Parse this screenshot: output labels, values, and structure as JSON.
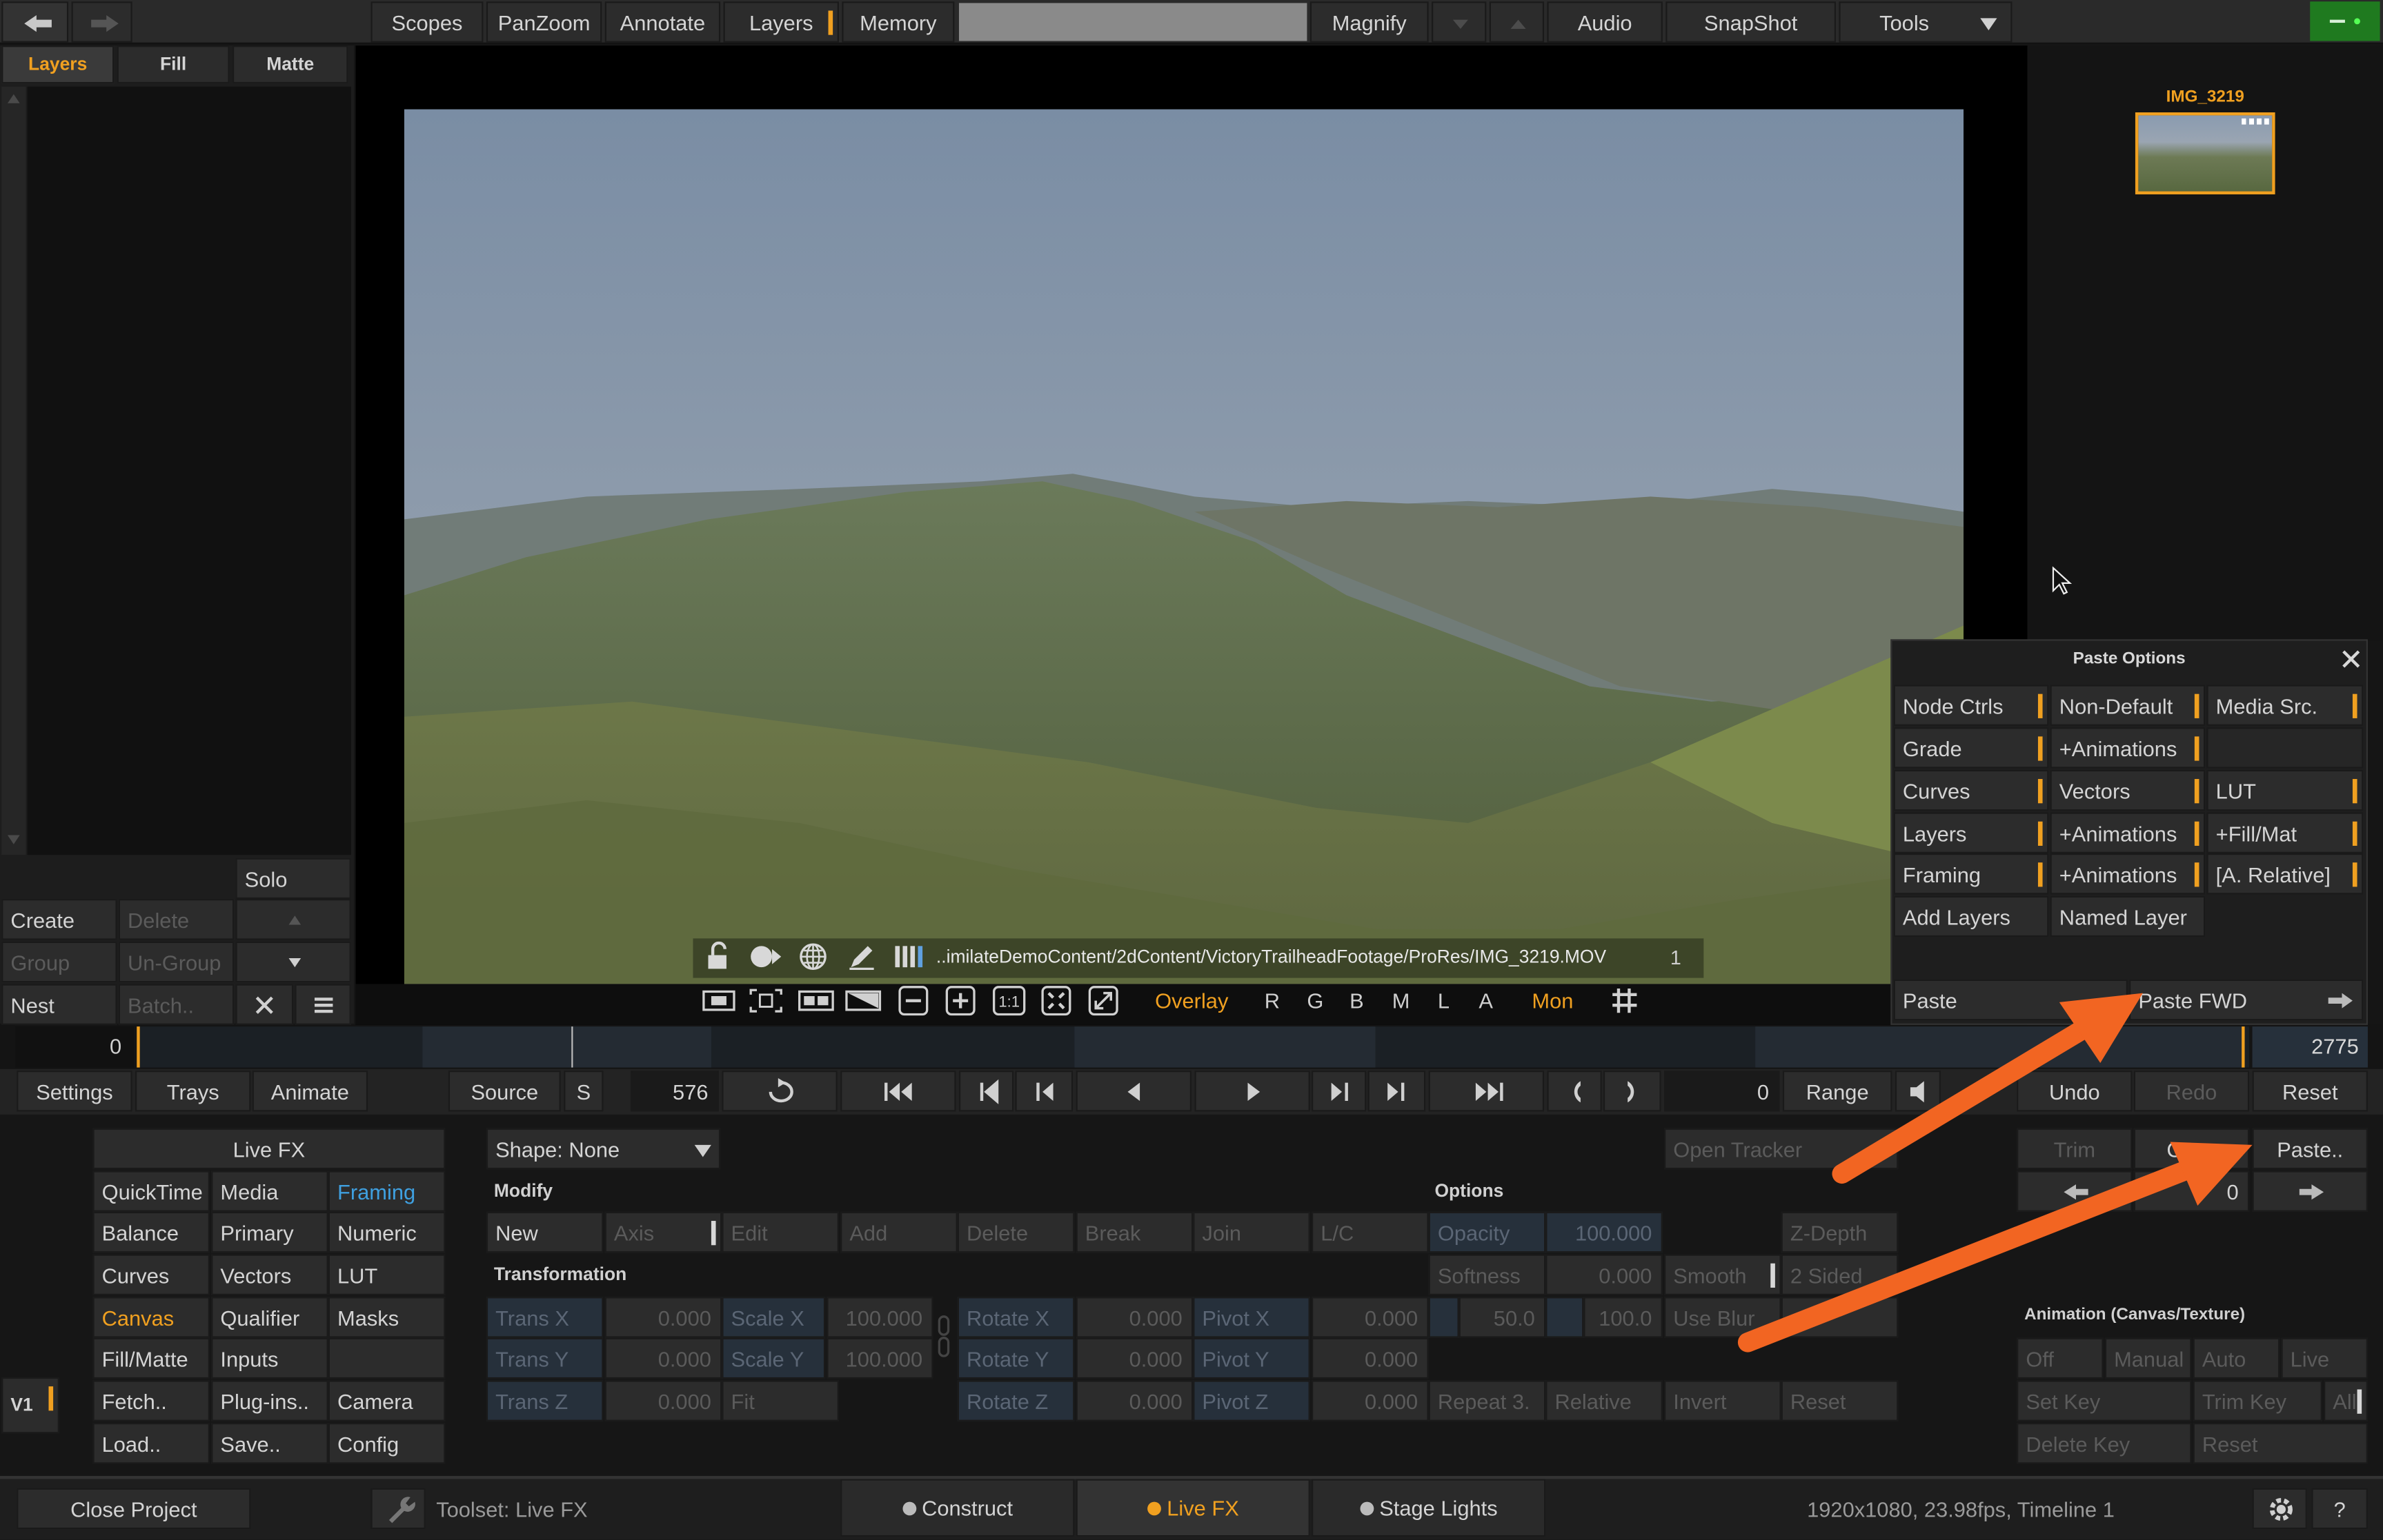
{
  "topbar": {
    "scopes": "Scopes",
    "panzoom": "PanZoom",
    "annotate": "Annotate",
    "layers": "Layers",
    "memory": "Memory",
    "magnify": "Magnify",
    "audio": "Audio",
    "snapshot": "SnapShot",
    "tools": "Tools"
  },
  "left_tabs": {
    "layers": "Layers",
    "fill": "Fill",
    "matte": "Matte"
  },
  "left_buttons": {
    "solo": "Solo",
    "create": "Create",
    "delete": "Delete",
    "group": "Group",
    "ungroup": "Un-Group",
    "nest": "Nest",
    "batch": "Batch.."
  },
  "thumbnail": {
    "label": "IMG_3219"
  },
  "viewer": {
    "file_path": "..imilateDemoContent/2dContent/VictoryTrailheadFootage/ProRes/IMG_3219.MOV",
    "frame_index": "1",
    "overlay": "Overlay",
    "channels": [
      "R",
      "G",
      "B",
      "M",
      "L",
      "A"
    ],
    "mon": "Mon"
  },
  "paste_options": {
    "title": "Paste Options",
    "rows": [
      [
        "Node Ctrls",
        "Non-Default",
        "Media Src."
      ],
      [
        "Grade",
        "+Animations",
        ""
      ],
      [
        "Curves",
        "Vectors",
        "LUT"
      ],
      [
        "Layers",
        "+Animations",
        "+Fill/Mat"
      ],
      [
        "Framing",
        "+Animations",
        "[A. Relative]"
      ],
      [
        "Add Layers",
        "Named Layer",
        ""
      ]
    ],
    "paste": "Paste",
    "paste_fwd": "Paste FWD"
  },
  "timeline": {
    "start": "0",
    "end": "2775"
  },
  "transport": {
    "settings": "Settings",
    "trays": "Trays",
    "animate": "Animate",
    "source": "Source",
    "s": "S",
    "frame": "576",
    "offset": "0",
    "range": "Range",
    "undo": "Undo",
    "redo": "Redo",
    "reset": "Reset"
  },
  "livefx_menu": {
    "title": "Live FX",
    "items": [
      [
        "QuickTime",
        "Media",
        "Framing"
      ],
      [
        "Balance",
        "Primary",
        "Numeric"
      ],
      [
        "Curves",
        "Vectors",
        "LUT"
      ],
      [
        "Canvas",
        "Qualifier",
        "Masks"
      ],
      [
        "Fill/Matte",
        "Inputs",
        ""
      ],
      [
        "Fetch..",
        "Plug-ins..",
        "Camera"
      ],
      [
        "Load..",
        "Save..",
        "Config"
      ]
    ]
  },
  "track": {
    "v1": "V1"
  },
  "shape": {
    "label": "Shape: None",
    "modify": "Modify",
    "transformation": "Transformation",
    "options": "Options",
    "open_tracker": "Open Tracker",
    "modify_buttons": [
      "New",
      "Axis",
      "Edit",
      "Add",
      "Delete",
      "Break",
      "Join",
      "L/C"
    ],
    "trans_x": "Trans X",
    "trans_x_val": "0.000",
    "trans_y": "Trans Y",
    "trans_y_val": "0.000",
    "trans_z": "Trans Z",
    "trans_z_val": "0.000",
    "scale_x": "Scale X",
    "scale_x_val": "100.000",
    "scale_y": "Scale Y",
    "scale_y_val": "100.000",
    "fit": "Fit",
    "rotate_x": "Rotate X",
    "rotate_x_val": "0.000",
    "rotate_y": "Rotate Y",
    "rotate_y_val": "0.000",
    "rotate_z": "Rotate Z",
    "rotate_z_val": "0.000",
    "pivot_x": "Pivot X",
    "pivot_x_val": "0.000",
    "pivot_y": "Pivot Y",
    "pivot_y_val": "0.000",
    "pivot_z": "Pivot Z",
    "pivot_z_val": "0.000",
    "opacity": "Opacity",
    "opacity_val": "100.000",
    "softness": "Softness",
    "softness_val": "0.000",
    "smooth": "Smooth",
    "two_sided": "2 Sided",
    "z_depth": "Z-Depth",
    "soft_a": "50.0",
    "soft_b": "100.0",
    "use_blur": "Use Blur",
    "repeat": "Repeat 3.",
    "relative": "Relative",
    "invert": "Invert",
    "reset": "Reset"
  },
  "right_panel": {
    "trim": "Trim",
    "copy": "Copy",
    "paste": "Paste..",
    "copy_val": "0",
    "animation_title": "Animation (Canvas/Texture)",
    "anim_row1": [
      "Off",
      "Manual",
      "Auto",
      "Live"
    ],
    "set_key": "Set Key",
    "trim_key": "Trim Key",
    "all": "All",
    "delete_key": "Delete Key",
    "reset": "Reset"
  },
  "bottombar": {
    "close_project": "Close Project",
    "toolset": "Toolset: Live FX",
    "construct": "Construct",
    "livefx": "Live FX",
    "stage_lights": "Stage Lights",
    "status": "1920x1080, 23.98fps, Timeline 1",
    "help": "?"
  },
  "colors": {
    "accent": "#f0a020",
    "arrow": "#f26522",
    "active_tab": "#f0a020",
    "framing_highlight": "#3fa0e0"
  }
}
